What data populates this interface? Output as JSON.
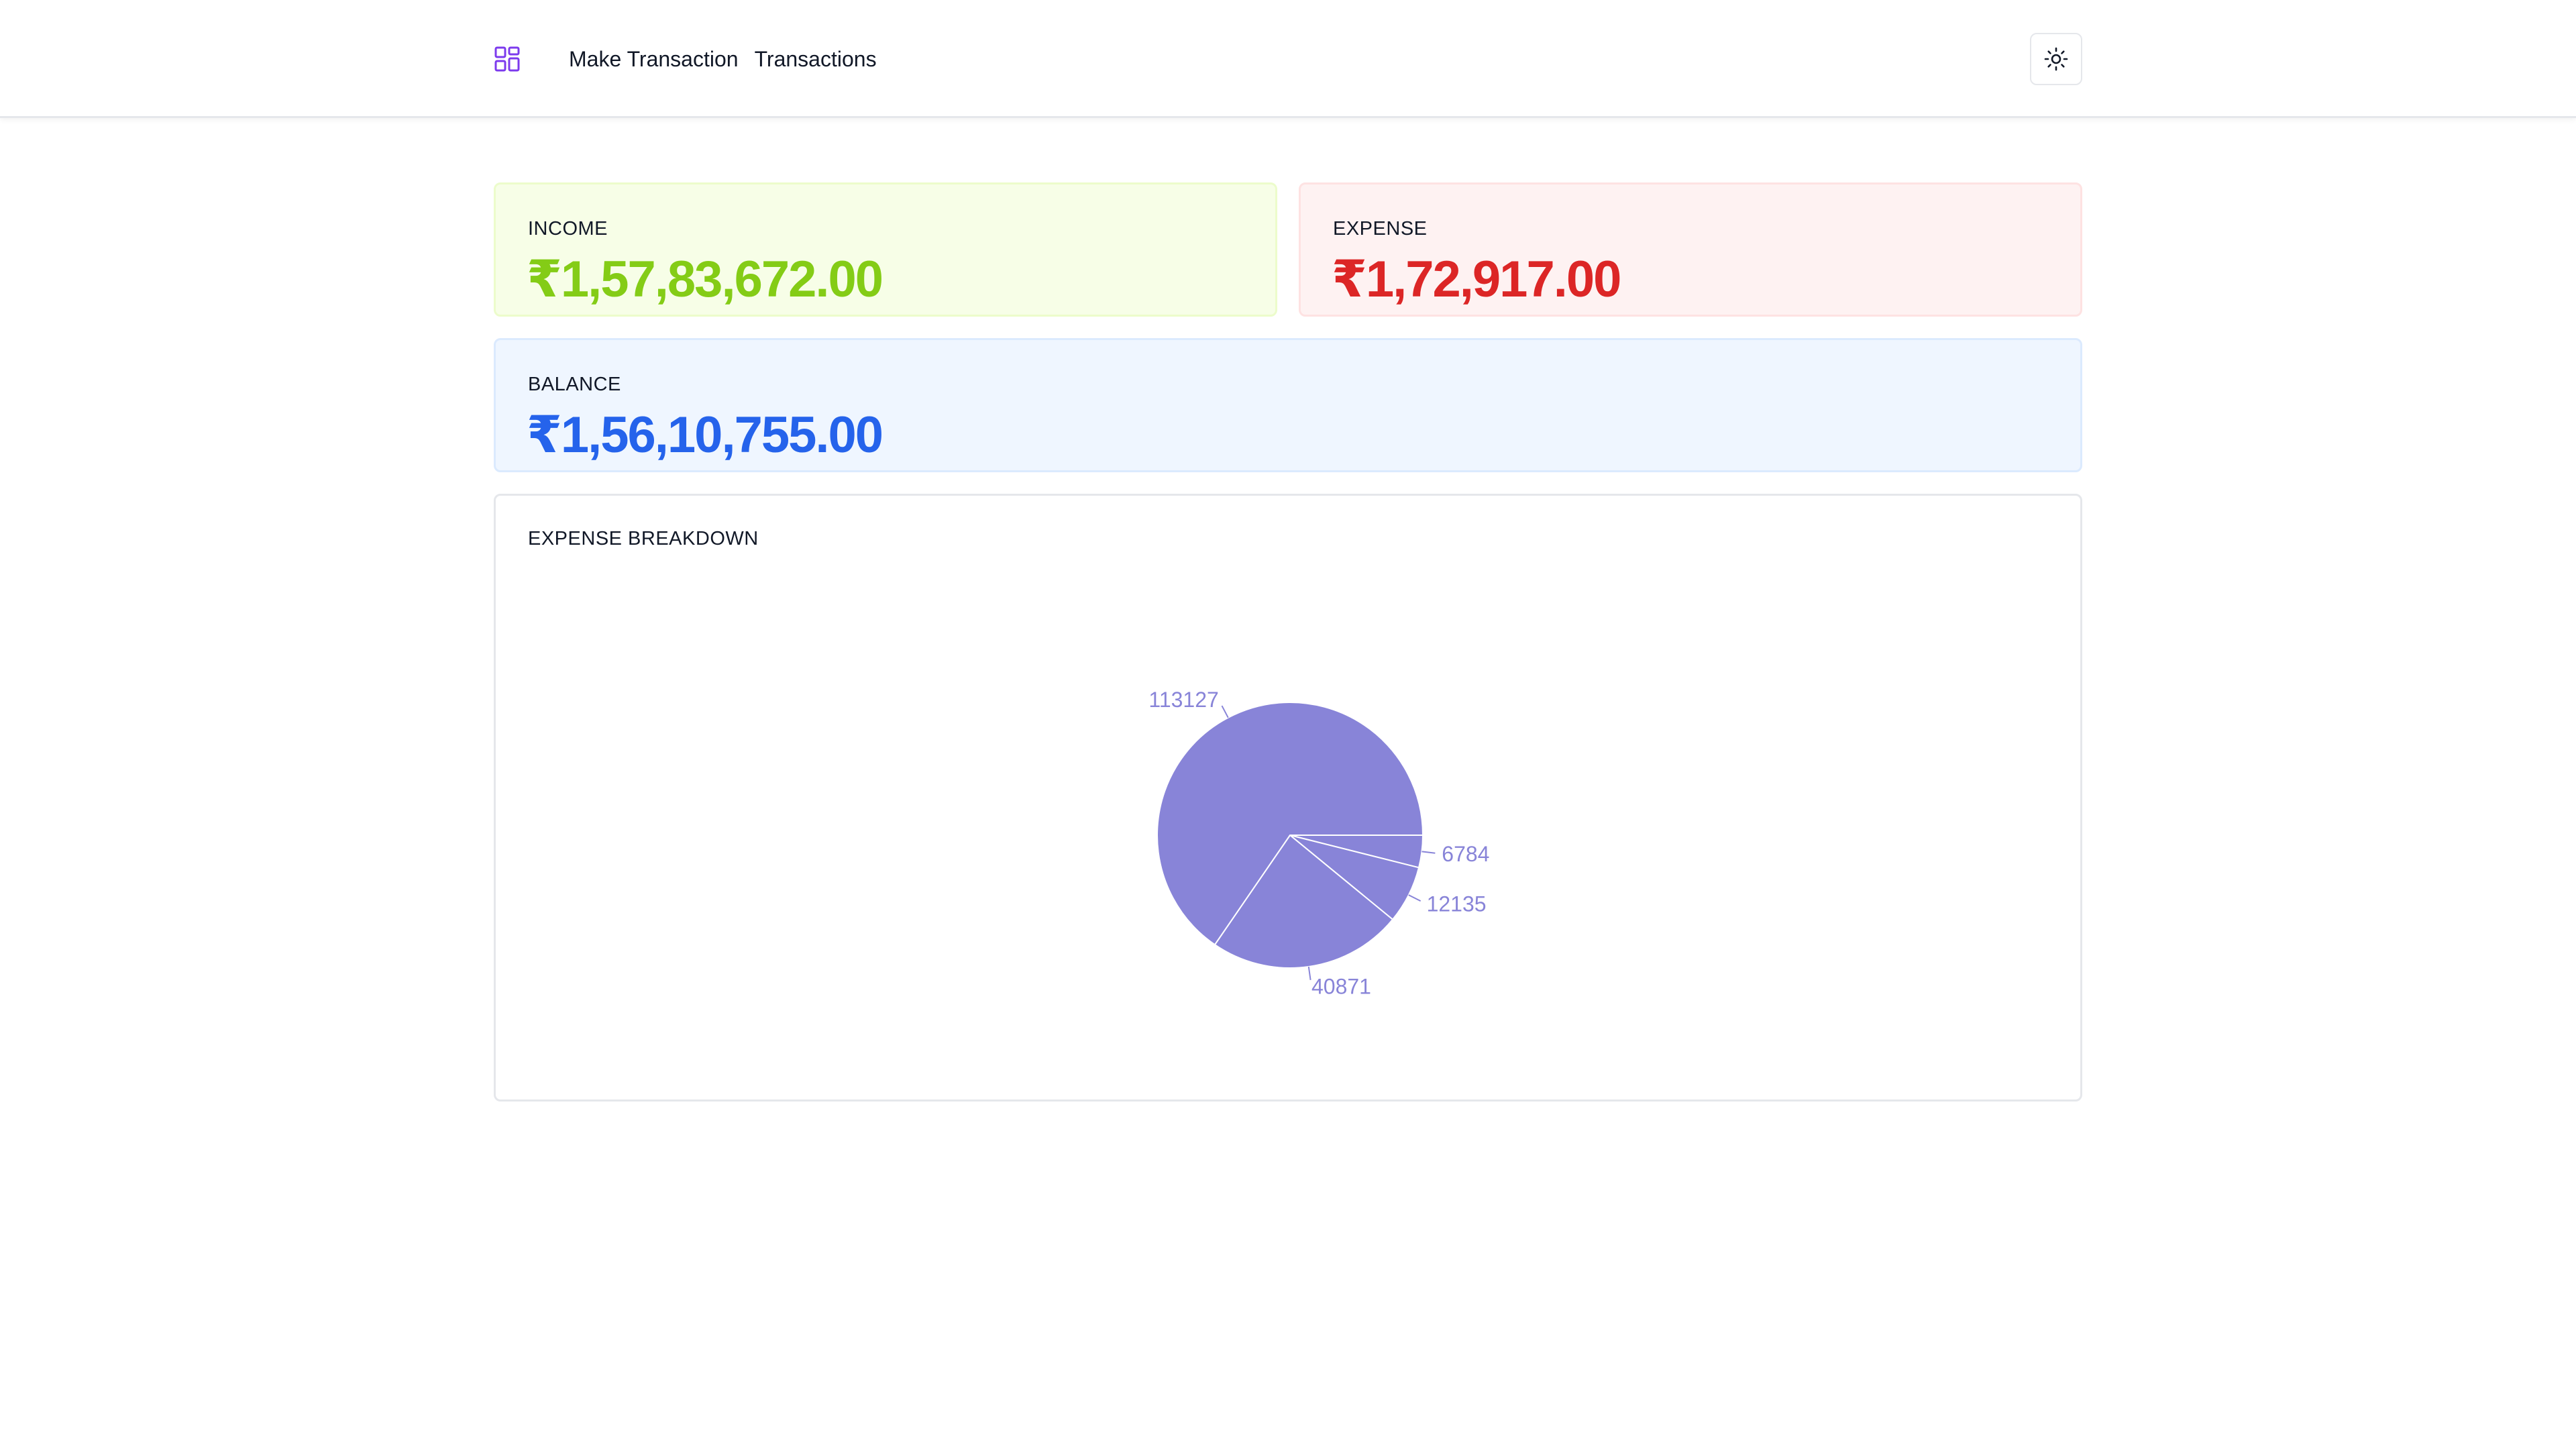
{
  "nav": {
    "logo_icon": "dashboard-grid-icon",
    "links": [
      "Make Transaction",
      "Transactions"
    ],
    "theme_toggle_icon": "sun-icon"
  },
  "summary": {
    "income": {
      "label": "INCOME",
      "value": "₹1,57,83,672.00",
      "color": "#84cc16"
    },
    "expense": {
      "label": "EXPENSE",
      "value": "₹1,72,917.00",
      "color": "#dc2626"
    },
    "balance": {
      "label": "BALANCE",
      "value": "₹1,56,10,755.00",
      "color": "#2563eb"
    }
  },
  "breakdown": {
    "title": "EXPENSE BREAKDOWN"
  },
  "chart_data": {
    "type": "pie",
    "title": "",
    "slice_color": "#8884d8",
    "label_color": "#8884d8",
    "values": [
      6784,
      12135,
      40871,
      113127
    ]
  }
}
